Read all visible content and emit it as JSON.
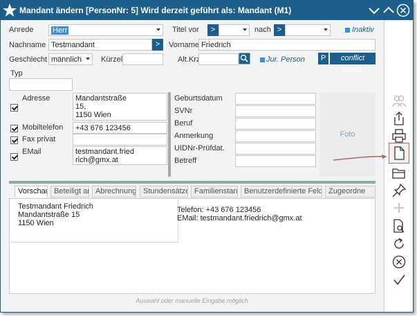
{
  "window": {
    "title": "Mandant ändern  [PersonNr: 5] Wird derzeit geführt als: Mandant (M1)"
  },
  "form": {
    "anrede_label": "Anrede",
    "anrede_value": "Herr",
    "titel_vor_label": "Titel vor",
    "titel_vor_button": ">",
    "nach_label": "nach",
    "nach_button": ">",
    "inaktiv_label": "Inaktiv",
    "nachname_label": "Nachname",
    "nachname_value": "Testmandant",
    "nachname_button": ">",
    "vorname_label": "Vorname",
    "vorname_value": "Friedrich",
    "geschlecht_label": "Geschlecht",
    "geschlecht_value": "männlich",
    "kuerzel_label": "Kürzel",
    "altkrz_label": "Alt.Krz",
    "jur_person_label": "Jur. Person",
    "p_button": "P",
    "conflict_check_label": "conflict check",
    "typ_label": "Typ",
    "adresse_label": "Adresse",
    "adresse_value_line1": "Mandantstraße",
    "adresse_value_line2": "15,",
    "adresse_value_line3": "1150 Wien",
    "mobiltelefon_label": "Mobiltelefon",
    "mobiltelefon_value": "+43 676 123456",
    "fax_privat_label": "Fax privat",
    "email_label": "EMail",
    "email_value_line1": "testmandant.fried",
    "email_value_line2": "rich@gmx.at",
    "geburtsdatum_label": "Geburtsdatum",
    "svnr_label": "SVNr",
    "beruf_label": "Beruf",
    "anmerkung_label": "Anmerkung",
    "uidnr_label": "UIDNr-Prüfdat.",
    "betreff_label": "Betreff",
    "foto_label": "Foto"
  },
  "tabs": [
    {
      "label": "Vorschau"
    },
    {
      "label": "Beteiligt an"
    },
    {
      "label": "Abrechnung"
    },
    {
      "label": "Stundensätze"
    },
    {
      "label": "Familienstand"
    },
    {
      "label": "Benutzerdefinierte Felder"
    },
    {
      "label": "Zugeordne"
    }
  ],
  "preview": {
    "name": "Testmandant Friedrich",
    "street": "Mandantstraße 15",
    "city": "1150 Wien",
    "telefon": "Telefon:  +43 676 123456",
    "email": "EMail:  testmandant.friedrich@gmx.at"
  },
  "statusbar": {
    "hint": "Auswahl oder manuelle Eingabe möglich"
  },
  "colors": {
    "titlebar": "#1d5e8a",
    "accent": "#3b8fd6",
    "selection_border": "#b56a6a"
  },
  "sidebar_icons": [
    "persons-icon",
    "share-export-icon",
    "print-icon",
    "new-document-icon",
    "open-folder-icon",
    "pin-icon",
    "add-icon",
    "document-search-icon",
    "refresh-icon",
    "cancel-icon",
    "confirm-icon"
  ]
}
